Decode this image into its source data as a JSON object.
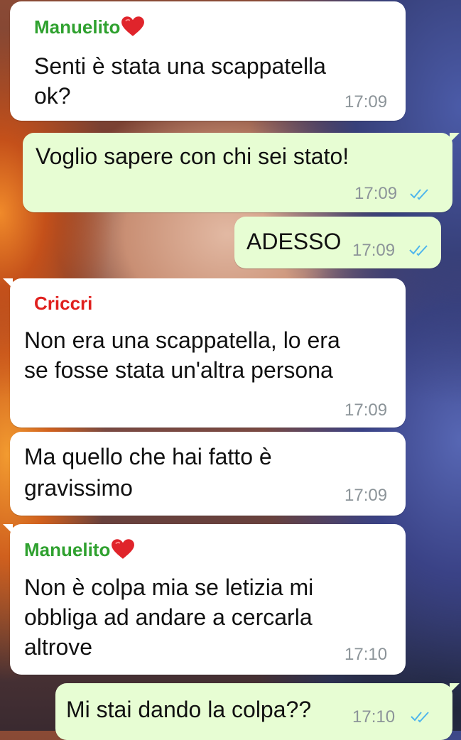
{
  "colors": {
    "sender_manuelito": "#2fa12f",
    "sender_criccri": "#e0201e",
    "incoming_bubble": "#ffffff",
    "outgoing_bubble": "#e7fdd3",
    "timestamp": "#8c9499",
    "read_ticks": "#4fb5ec"
  },
  "messages": [
    {
      "direction": "incoming",
      "sender": "Manuelito",
      "sender_icon": "red-heart-icon",
      "lines": [
        "Senti è stata una scappatella",
        "ok?"
      ],
      "time": "17:09"
    },
    {
      "direction": "outgoing",
      "lines": [
        "Voglio sapere con chi sei stato!"
      ],
      "time": "17:09",
      "status": "read"
    },
    {
      "direction": "outgoing",
      "lines": [
        "ADESSO"
      ],
      "time": "17:09",
      "status": "read"
    },
    {
      "direction": "incoming",
      "sender": "Criccri",
      "lines": [
        "Non era una scappatella, lo era",
        "se fosse stata un'altra persona"
      ],
      "time": "17:09"
    },
    {
      "direction": "incoming",
      "lines": [
        "Ma quello che hai fatto è",
        "gravissimo"
      ],
      "time": "17:09"
    },
    {
      "direction": "incoming",
      "sender": "Manuelito",
      "sender_icon": "red-heart-icon",
      "lines": [
        "Non è colpa mia se letizia mi",
        "obbliga ad andare a cercarla",
        "altrove"
      ],
      "time": "17:10"
    },
    {
      "direction": "outgoing",
      "lines": [
        "Mi stai dando la colpa??"
      ],
      "time": "17:10",
      "status": "read"
    }
  ]
}
